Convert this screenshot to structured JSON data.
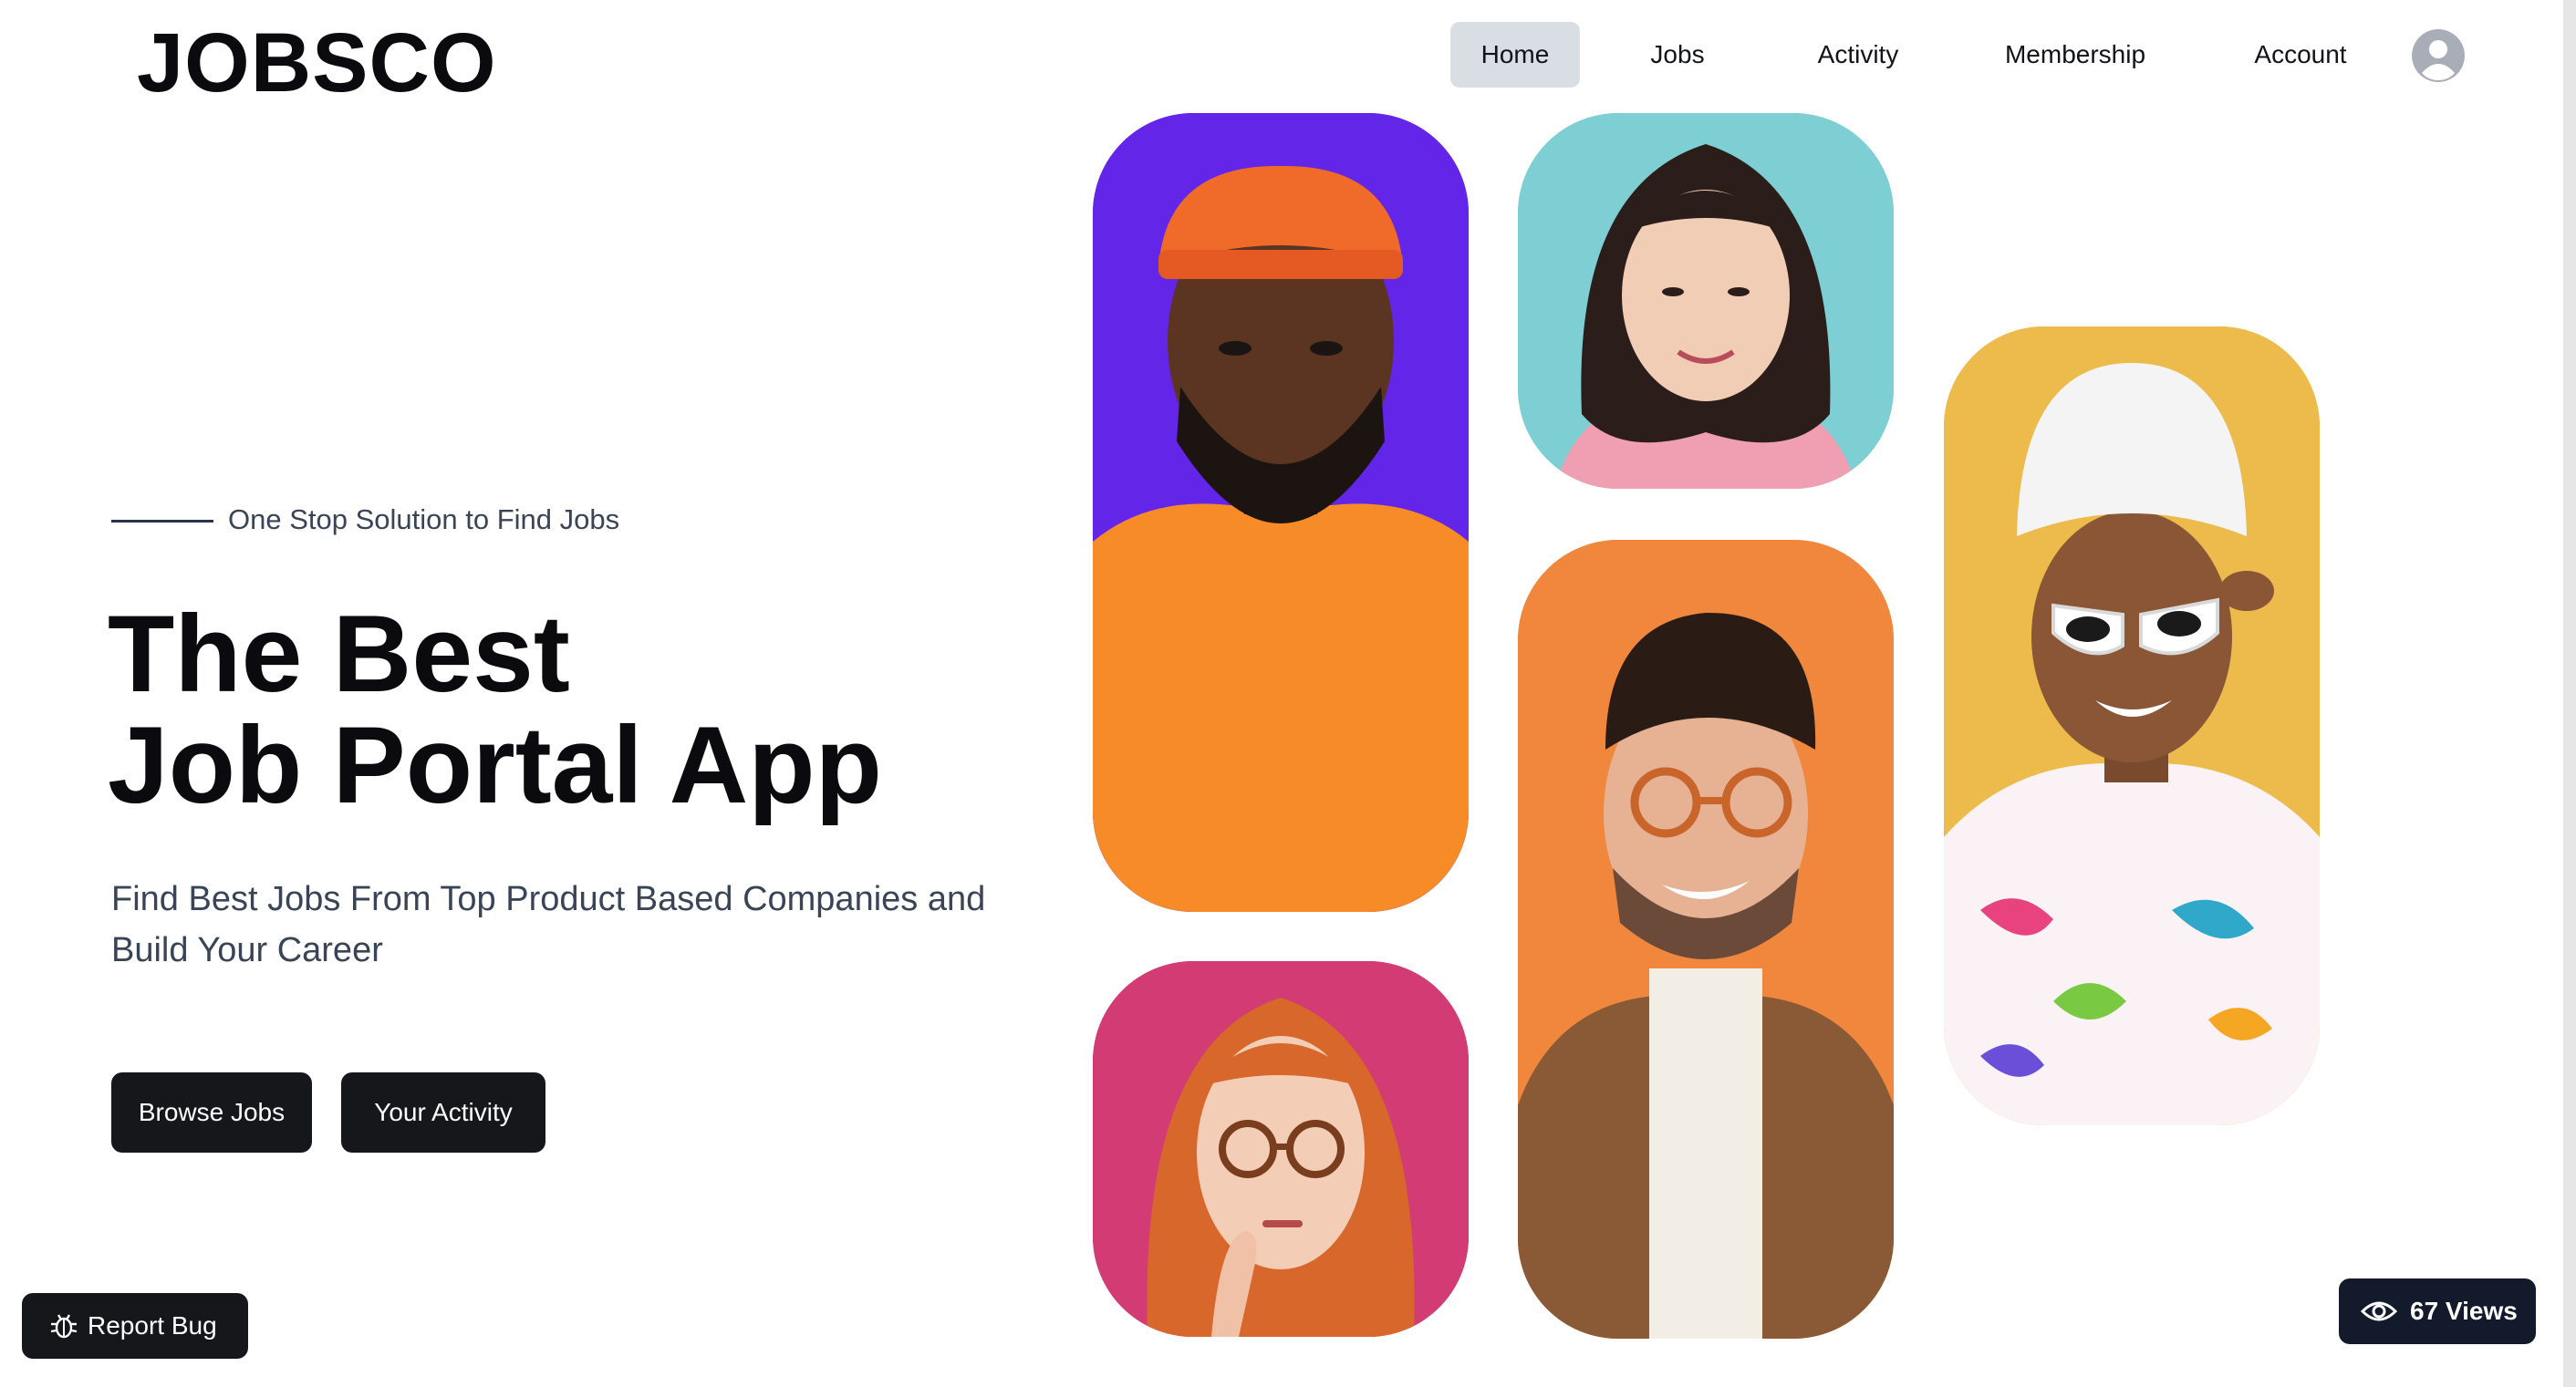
{
  "brand": {
    "logo": "JOBSCO"
  },
  "nav": {
    "items": [
      "Home",
      "Jobs",
      "Activity",
      "Membership",
      "Account"
    ],
    "active": "Home"
  },
  "hero": {
    "tagline": "One Stop Solution to Find Jobs",
    "title_line1": "The Best",
    "title_line2": "Job Portal App",
    "subtitle": "Find Best Jobs From Top Product Based Companies and Build Your Career",
    "primary_button": "Browse Jobs",
    "secondary_button": "Your Activity"
  },
  "photos": [
    {
      "subject": "man in orange beanie",
      "background": "#6326e8"
    },
    {
      "subject": "smiling woman in pink sweater",
      "background": "#7ecfd4"
    },
    {
      "subject": "woman with white towel and sunglasses",
      "background": "#edbb4c"
    },
    {
      "subject": "man with glasses and brown jacket",
      "background": "#f0873d"
    },
    {
      "subject": "red-haired woman with glasses",
      "background": "#d23b74"
    }
  ],
  "floating": {
    "report_bug": "Report Bug",
    "views": "67 Views"
  },
  "icons": {
    "avatar": "user-avatar-icon",
    "bug": "bug-icon",
    "eye": "eye-icon"
  },
  "colors": {
    "primary_dark": "#16171b",
    "views_badge": "#121a2c",
    "nav_active": "#d9dde4",
    "text_muted": "#3a4457"
  }
}
